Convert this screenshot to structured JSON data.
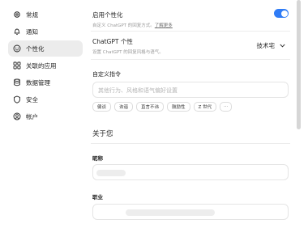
{
  "sidebar": {
    "items": [
      {
        "label": "常规",
        "icon": "gear-icon"
      },
      {
        "label": "通知",
        "icon": "bell-icon"
      },
      {
        "label": "个性化",
        "icon": "personalization-icon",
        "active": true
      },
      {
        "label": "关联的应用",
        "icon": "apps-grid-icon"
      },
      {
        "label": "数据管理",
        "icon": "database-icon"
      },
      {
        "label": "安全",
        "icon": "shield-icon"
      },
      {
        "label": "帐户",
        "icon": "account-icon"
      }
    ]
  },
  "personalization": {
    "enable_title": "启用个性化",
    "enable_sub": "自定义 ChatGPT 的回复方式。",
    "learn_more": "了解更多",
    "enabled": true,
    "personality_title": "ChatGPT 个性",
    "personality_sub": "设置 ChatGPT 的回复风格与语气。",
    "personality_value": "技术宅",
    "instructions_title": "自定义指令",
    "instructions_placeholder": "其他行为、风格和语气偏好设置",
    "chips": [
      "健谈",
      "诙谐",
      "直言不讳",
      "鼓励性",
      "Z 世代",
      "···"
    ]
  },
  "about": {
    "title": "关于您",
    "nickname_label": "昵称",
    "job_label": "职业"
  },
  "colors": {
    "accent": "#2f7cf6"
  }
}
